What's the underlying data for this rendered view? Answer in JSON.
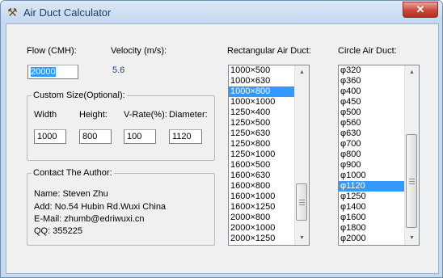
{
  "window": {
    "title": "Air Duct Calculator",
    "close_glyph": "✕",
    "app_icon": "tools-icon"
  },
  "flow": {
    "label": "Flow (CMH):",
    "value": "20000"
  },
  "velocity": {
    "label": "Velocity (m/s):",
    "value": "5.6"
  },
  "custom": {
    "title": "Custom Size(Optional):",
    "width_label": "Width",
    "width_value": "1000",
    "height_label": "Height:",
    "height_value": "800",
    "vrate_label": "V-Rate(%):",
    "vrate_value": "100",
    "diameter_label": "Diameter:",
    "diameter_value": "1120"
  },
  "contact": {
    "title": "Contact The Author:",
    "name": "Name: Steven Zhu",
    "address": "Add: No.54 Hubin Rd.Wuxi China",
    "email": "E-Mail: zhumb@edriwuxi.cn",
    "qq": "QQ: 355225"
  },
  "rect": {
    "label": "Rectangular Air Duct:",
    "items": [
      "1000×500",
      "1000×630",
      "1000×800",
      "1000×1000",
      "1250×400",
      "1250×500",
      "1250×630",
      "1250×800",
      "1250×1000",
      "1600×500",
      "1600×630",
      "1600×800",
      "1600×1000",
      "1600×1250",
      "2000×800",
      "2000×1000",
      "2000×1250"
    ],
    "selected": "1000×800"
  },
  "circle": {
    "label": "Circle Air Duct:",
    "items": [
      "φ320",
      "φ360",
      "φ400",
      "φ450",
      "φ500",
      "φ560",
      "φ630",
      "φ700",
      "φ800",
      "φ900",
      "φ1000",
      "φ1120",
      "φ1250",
      "φ1400",
      "φ1600",
      "φ1800",
      "φ2000"
    ],
    "selected": "φ1120"
  }
}
